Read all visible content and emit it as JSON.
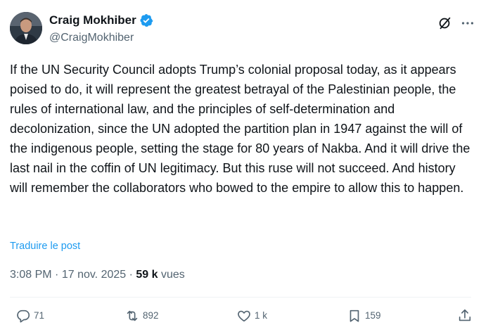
{
  "author": {
    "name": "Craig Mokhiber",
    "handle": "@CraigMokhiber",
    "verified": true
  },
  "tweet": {
    "text": "If the UN Security Council adopts Trump’s colonial proposal today, as it appears poised to do, it will represent the greatest betrayal of the Palestinian people, the rules of international law, and the principles of self-determination and decolonization, since the UN adopted the partition plan in 1947 against the will of the indigenous people, setting the stage for 80 years of Nakba. And it will drive the last nail in the coffin of UN legitimacy. But this ruse will not succeed. And history will remember the collaborators who bowed to the empire to allow this to happen.",
    "translate_label": "Traduire le post"
  },
  "meta": {
    "time": "3:08 PM",
    "separator": "·",
    "date": "17 nov. 2025",
    "views_count": "59 k",
    "views_label": "vues"
  },
  "actions": {
    "replies": "71",
    "reposts": "892",
    "likes": "1 k",
    "bookmarks": "159"
  },
  "icons": {
    "verified": "verified-badge-icon",
    "grok": "grok-icon",
    "more": "more-horizontal-icon",
    "reply": "reply-icon",
    "repost": "repost-icon",
    "like": "heart-icon",
    "bookmark": "bookmark-icon",
    "share": "share-icon"
  },
  "colors": {
    "text": "#0f1419",
    "secondary": "#536471",
    "link": "#1d9bf0",
    "verified": "#1d9bf0"
  }
}
